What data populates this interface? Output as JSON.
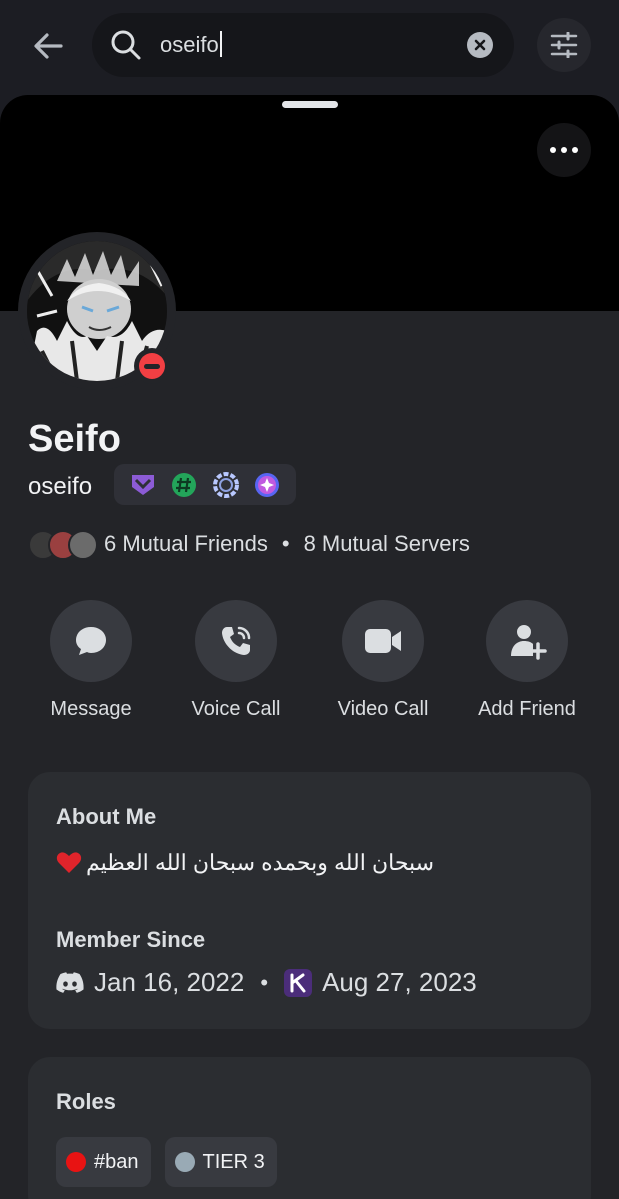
{
  "search": {
    "query": "oseifo"
  },
  "profile": {
    "display_name": "Seifo",
    "username": "oseifo",
    "status": "do-not-disturb",
    "badges": [
      "hypesquad-balance-icon",
      "hashtag-badge-icon",
      "nitro-boost-badge-icon",
      "quest-badge-icon"
    ],
    "mutual_friends": "6 Mutual Friends",
    "mutual_separator": "•",
    "mutual_servers": "8 Mutual Servers"
  },
  "actions": [
    {
      "label": "Message",
      "icon": "chat-bubble-icon"
    },
    {
      "label": "Voice Call",
      "icon": "phone-icon"
    },
    {
      "label": "Video Call",
      "icon": "video-camera-icon"
    },
    {
      "label": "Add Friend",
      "icon": "add-friend-icon"
    }
  ],
  "about": {
    "heading": "About Me",
    "text": "سبحان الله وبحمده سبحان الله العظيم",
    "member_since_heading": "Member Since",
    "discord_date": "Jan 16, 2022",
    "separator": "•",
    "server_date": "Aug 27, 2023"
  },
  "roles": {
    "heading": "Roles",
    "items": [
      {
        "name": "#ban",
        "color": "#e81313"
      },
      {
        "name": "TIER 3",
        "color": "#99aab5"
      }
    ]
  },
  "colors": {
    "background": "#1c1d23",
    "card": "#2b2d31",
    "dnd": "#f23f43"
  }
}
